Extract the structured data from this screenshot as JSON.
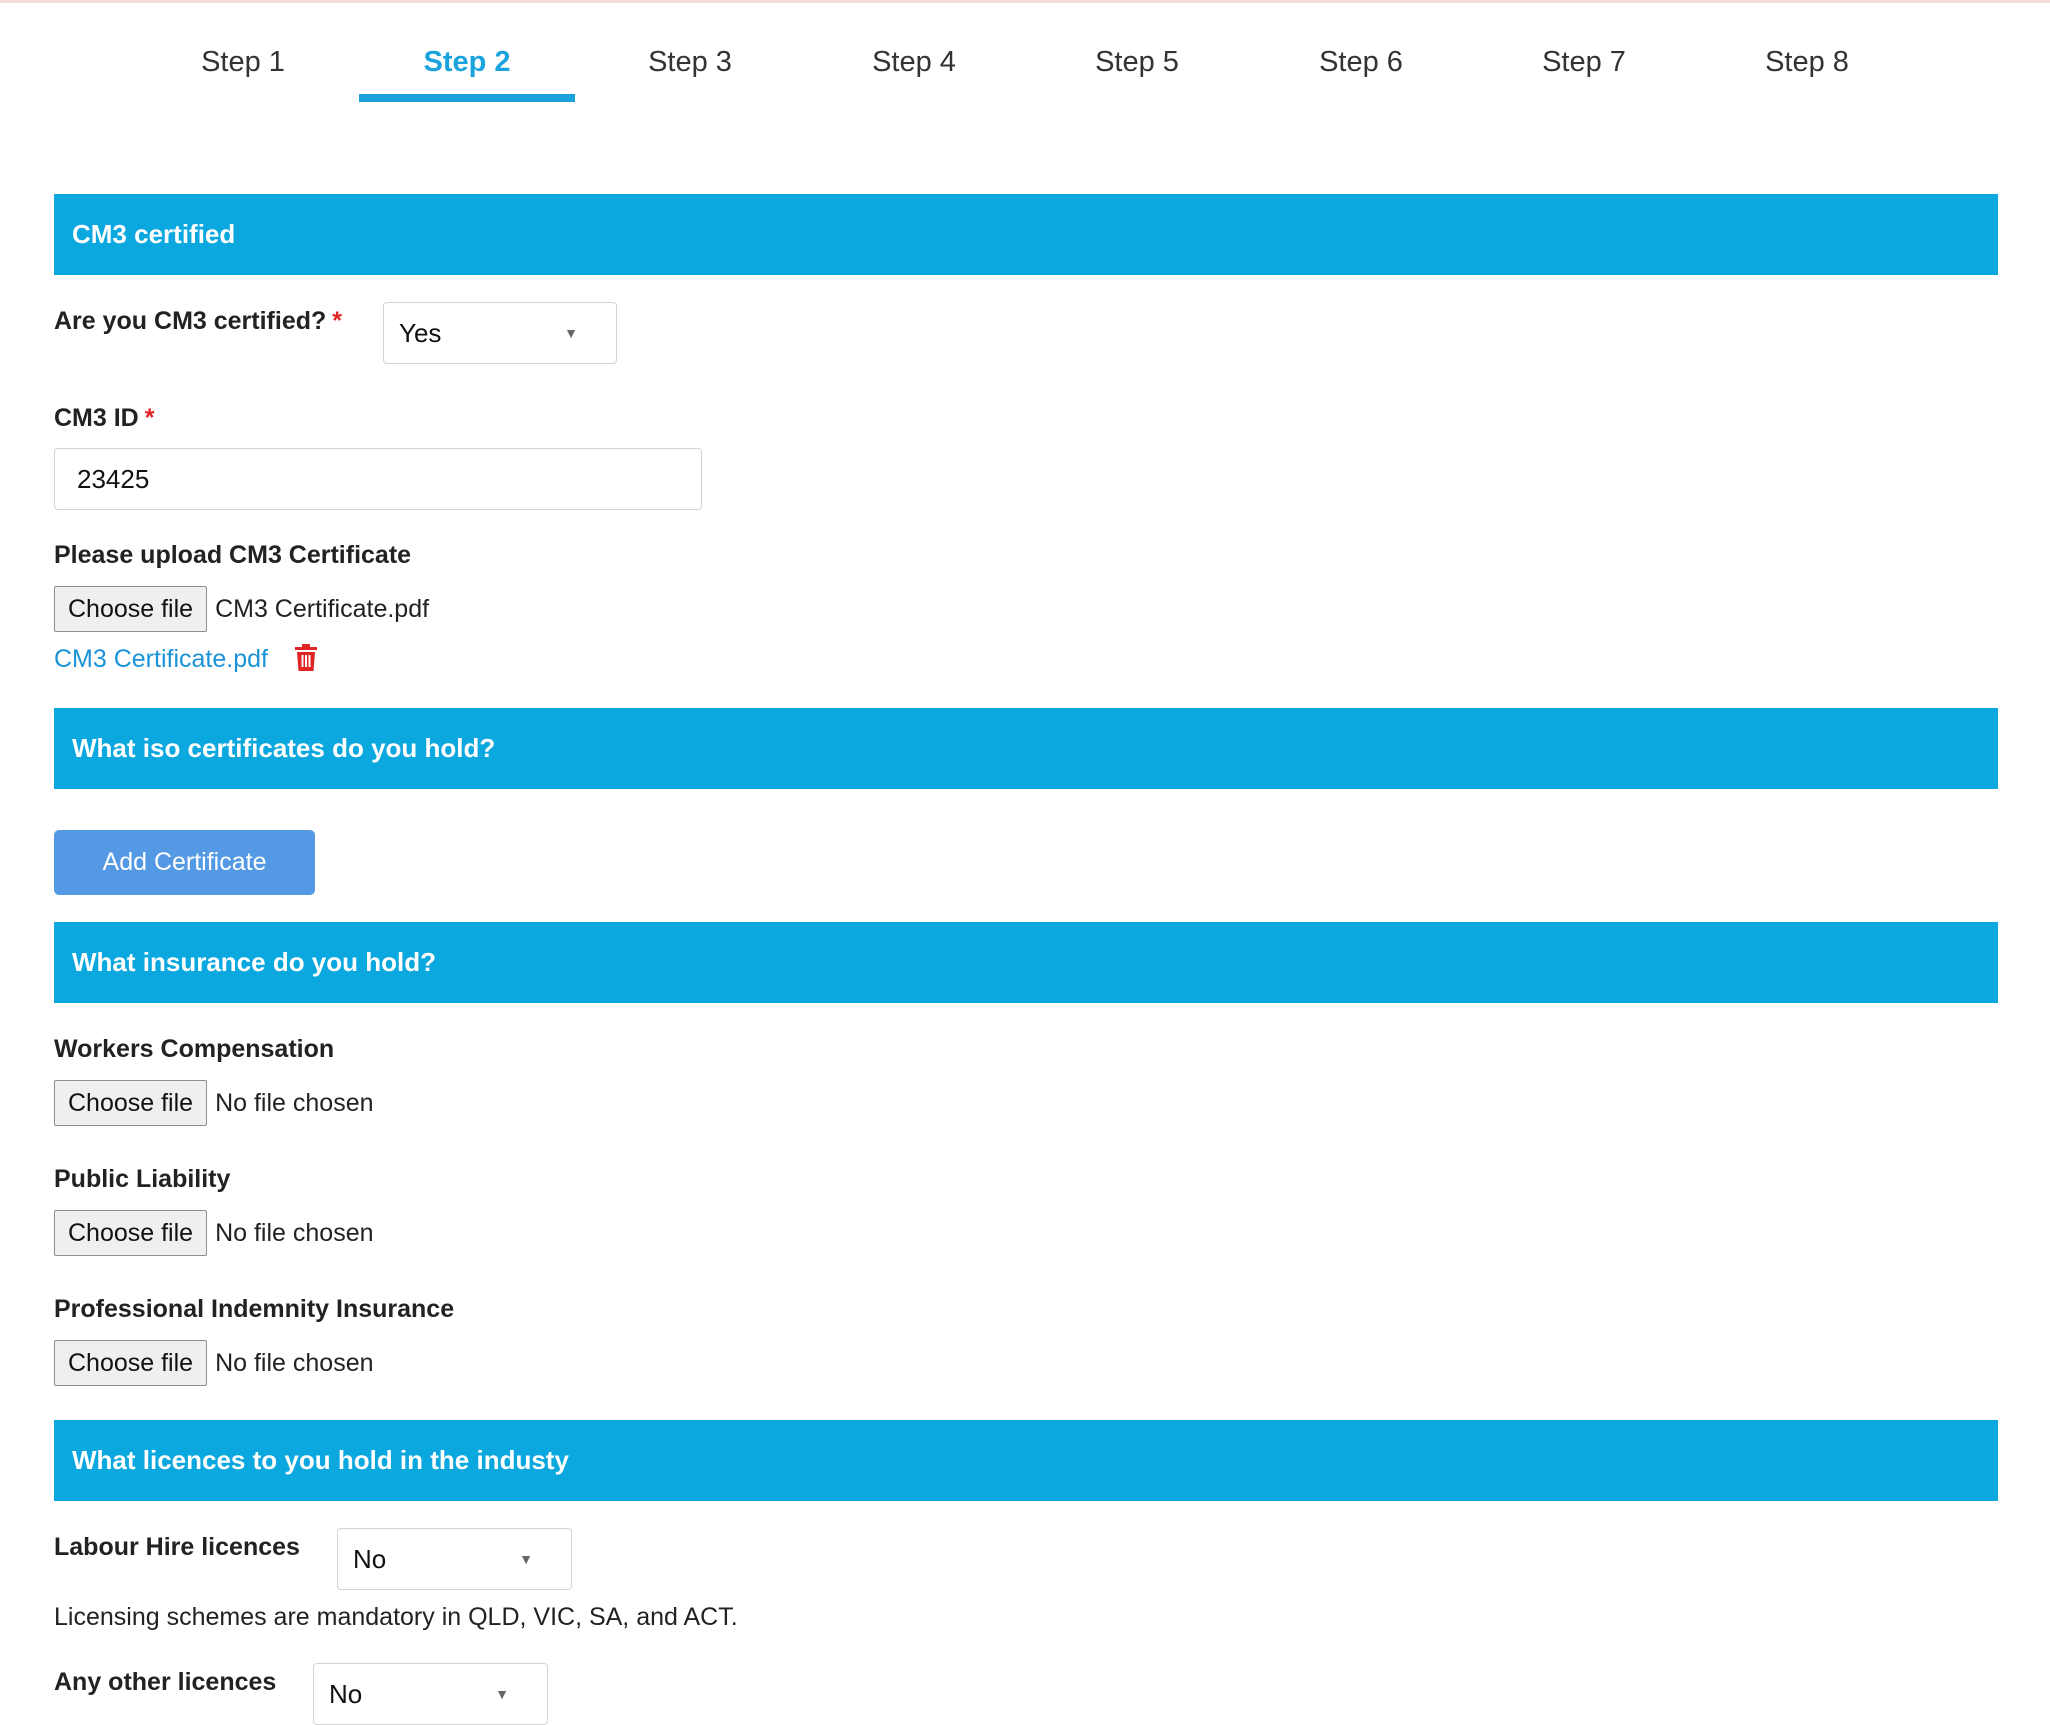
{
  "steps": [
    "Step 1",
    "Step 2",
    "Step 3",
    "Step 4",
    "Step 5",
    "Step 6",
    "Step 7",
    "Step 8"
  ],
  "active_step": "Step 2",
  "cm3": {
    "section_title": "CM3 certified",
    "certified_label": "Are you CM3 certified?",
    "required_mark": "*",
    "certified_value": "Yes",
    "id_label": "CM3 ID",
    "id_value": "23425",
    "upload_label": "Please upload CM3 Certificate",
    "choose_file": "Choose file",
    "chosen_file": "CM3 Certificate.pdf",
    "uploaded_link": "CM3 Certificate.pdf"
  },
  "iso": {
    "section_title": "What iso certificates do you hold?",
    "add_button": "Add Certificate"
  },
  "insurance": {
    "section_title": "What insurance do you hold?",
    "items": [
      {
        "label": "Workers Compensation",
        "button": "Choose file",
        "status": "No file chosen"
      },
      {
        "label": "Public Liability",
        "button": "Choose file",
        "status": "No file chosen"
      },
      {
        "label": "Professional Indemnity Insurance",
        "button": "Choose file",
        "status": "No file chosen"
      }
    ]
  },
  "licences": {
    "section_title": "What licences to you hold in the industy",
    "labour_hire_label": "Labour Hire licences",
    "labour_hire_value": "No",
    "note": "Licensing schemes are mandatory in QLD, VIC, SA, and ACT.",
    "other_label": "Any other licences",
    "other_value": "No"
  },
  "colors": {
    "accent": "#0ba7df",
    "tab_active": "#1aa3dc",
    "button": "#5499e3",
    "required": "#e02424",
    "link": "#1a93d8"
  }
}
